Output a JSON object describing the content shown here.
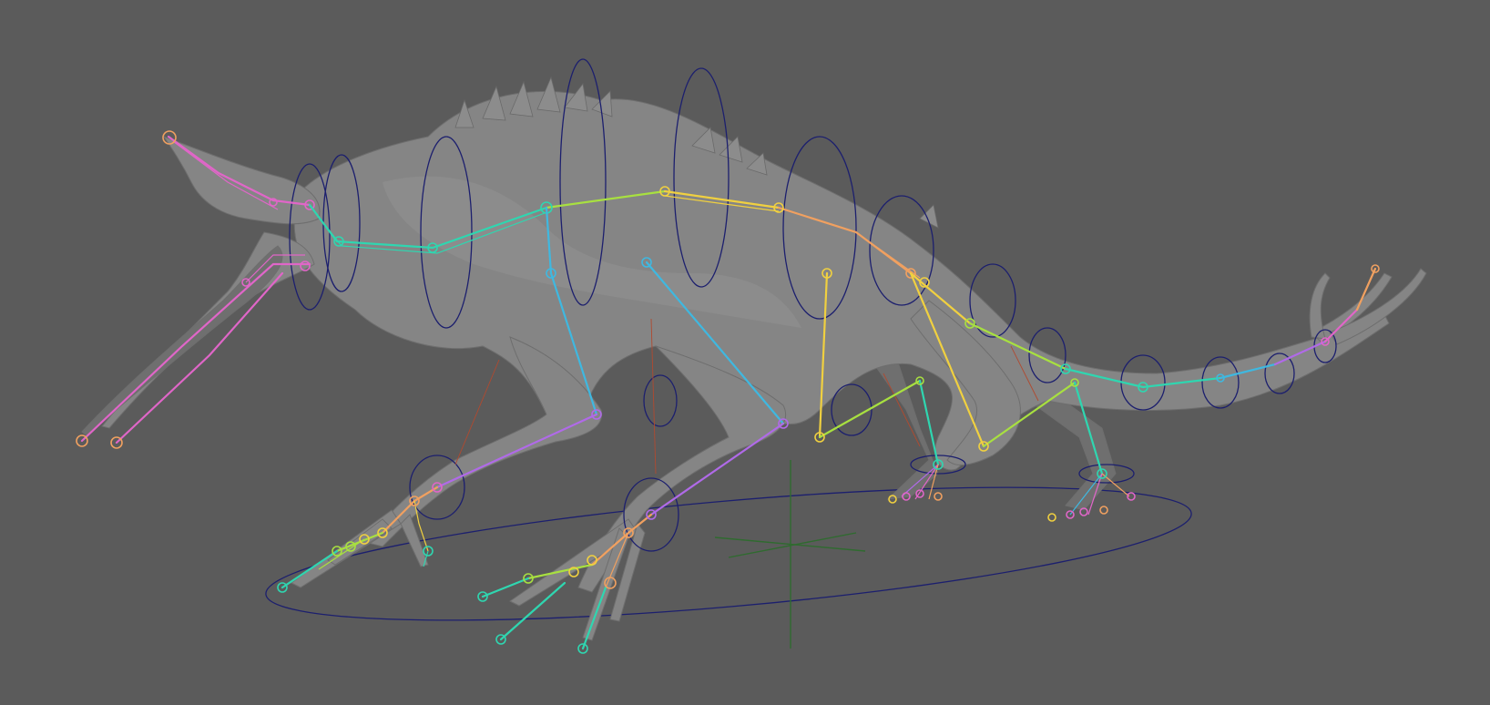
{
  "viewport": {
    "background": "#5b5b5b",
    "mesh_color": "#858585",
    "control_curve_color": "#1c1f6e",
    "ground_axis_color": "#2f6b2f"
  },
  "rig_chain_colors": {
    "head": "#e066c8",
    "neck": "#2fd6b0",
    "spine": "#f0d040",
    "spine_mid": "#f0a060",
    "front_leg": "#3fb8e0",
    "front_lower": "#b06ae8",
    "back_leg": "#f0d040",
    "back_lower": "#a8e040",
    "tail": "#2fd6b0",
    "tail_end": "#e066c8",
    "toes": "#f0a060"
  }
}
